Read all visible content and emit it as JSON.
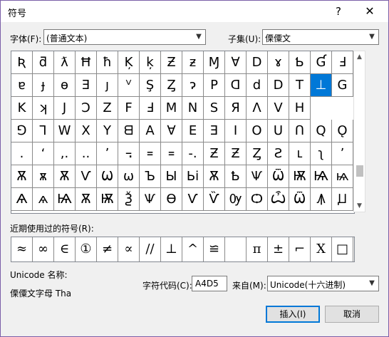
{
  "window": {
    "title": "符号",
    "help": "?",
    "close": "✕"
  },
  "font": {
    "label": "字体(F):",
    "value": "(普通文本)"
  },
  "subset": {
    "label": "子集(U):",
    "value": "傈僳文"
  },
  "grid": [
    [
      "Ʀ",
      "ƌ",
      "ƛ",
      "Ħ",
      "ħ",
      "Ķ",
      "ķ",
      "Ƶ",
      "ƶ",
      "Ɱ",
      "∀",
      "D",
      "ɤ",
      "Ƅ",
      "Ɠ",
      "Ⅎ",
      "ꝼ",
      "φ"
    ],
    [
      "ɐ",
      "ɟ",
      "ɵ",
      "Ǝ",
      "ȷ",
      "ⱽ",
      "Ş",
      "Ȥ",
      "ɂ",
      "P",
      "ᗡ",
      "d",
      "D",
      "T",
      "⊥",
      "G"
    ],
    [
      "K",
      "ʞ",
      "J",
      "Ɔ",
      "Z",
      "F",
      "Ⅎ",
      "M",
      "N",
      "S",
      "Я",
      "Λ",
      "V",
      "H"
    ],
    [
      "⅁",
      "⅂",
      "W",
      "X",
      "Y",
      "ᗺ",
      "A",
      "∀",
      "E",
      "Ǝ",
      "I",
      "O",
      "U",
      "Ո",
      "Q",
      "Ǫ"
    ],
    [
      ".",
      "ʻ",
      ",.",
      "..",
      "ʼ",
      "꓾",
      "꓿",
      "꓿",
      "-.",
      "Ƶ",
      "Ƶ",
      "Ȥ",
      "Ƨ",
      "ⳑ",
      "ʅ",
      "ʼ"
    ],
    [
      "Ѫ",
      "ѫ",
      "Ѫ",
      "Ѵ",
      "Ѡ",
      "ѡ",
      "Ъ",
      "Ы",
      "Ьі",
      "Ѫ",
      "Ҍ",
      "Ѱ",
      "Ѿ",
      "Ѭ",
      "Ѩ",
      "ѩ"
    ],
    [
      "Ѧ",
      "ѧ",
      "Ѩ",
      "Ѫ",
      "Ѭ",
      "Ѯ",
      "Ѱ",
      "Ѳ",
      "Ѵ",
      "Ѷ",
      "Ѹ",
      "Ѻ",
      "Ѽ",
      "Ѿ",
      "Ꙟ",
      "Ꙡ"
    ]
  ],
  "selected_cell": "⊥",
  "recent": {
    "label": "近期使用过的符号(R):",
    "symbols": [
      "≈",
      "∞",
      "∈",
      "①",
      "≠",
      "∝",
      "//",
      "⊥",
      "^",
      "≌",
      "",
      "π",
      "±",
      "⌐",
      "Ⅹ",
      "□"
    ]
  },
  "unicode": {
    "name_label": "Unicode 名称:",
    "name_value": "傈僳文字母 Tha"
  },
  "code": {
    "label": "字符代码(C):",
    "value": "A4D5"
  },
  "from": {
    "label": "来自(M):",
    "value": "Unicode(十六进制)"
  },
  "buttons": {
    "insert": "插入(I)",
    "cancel": "取消"
  }
}
